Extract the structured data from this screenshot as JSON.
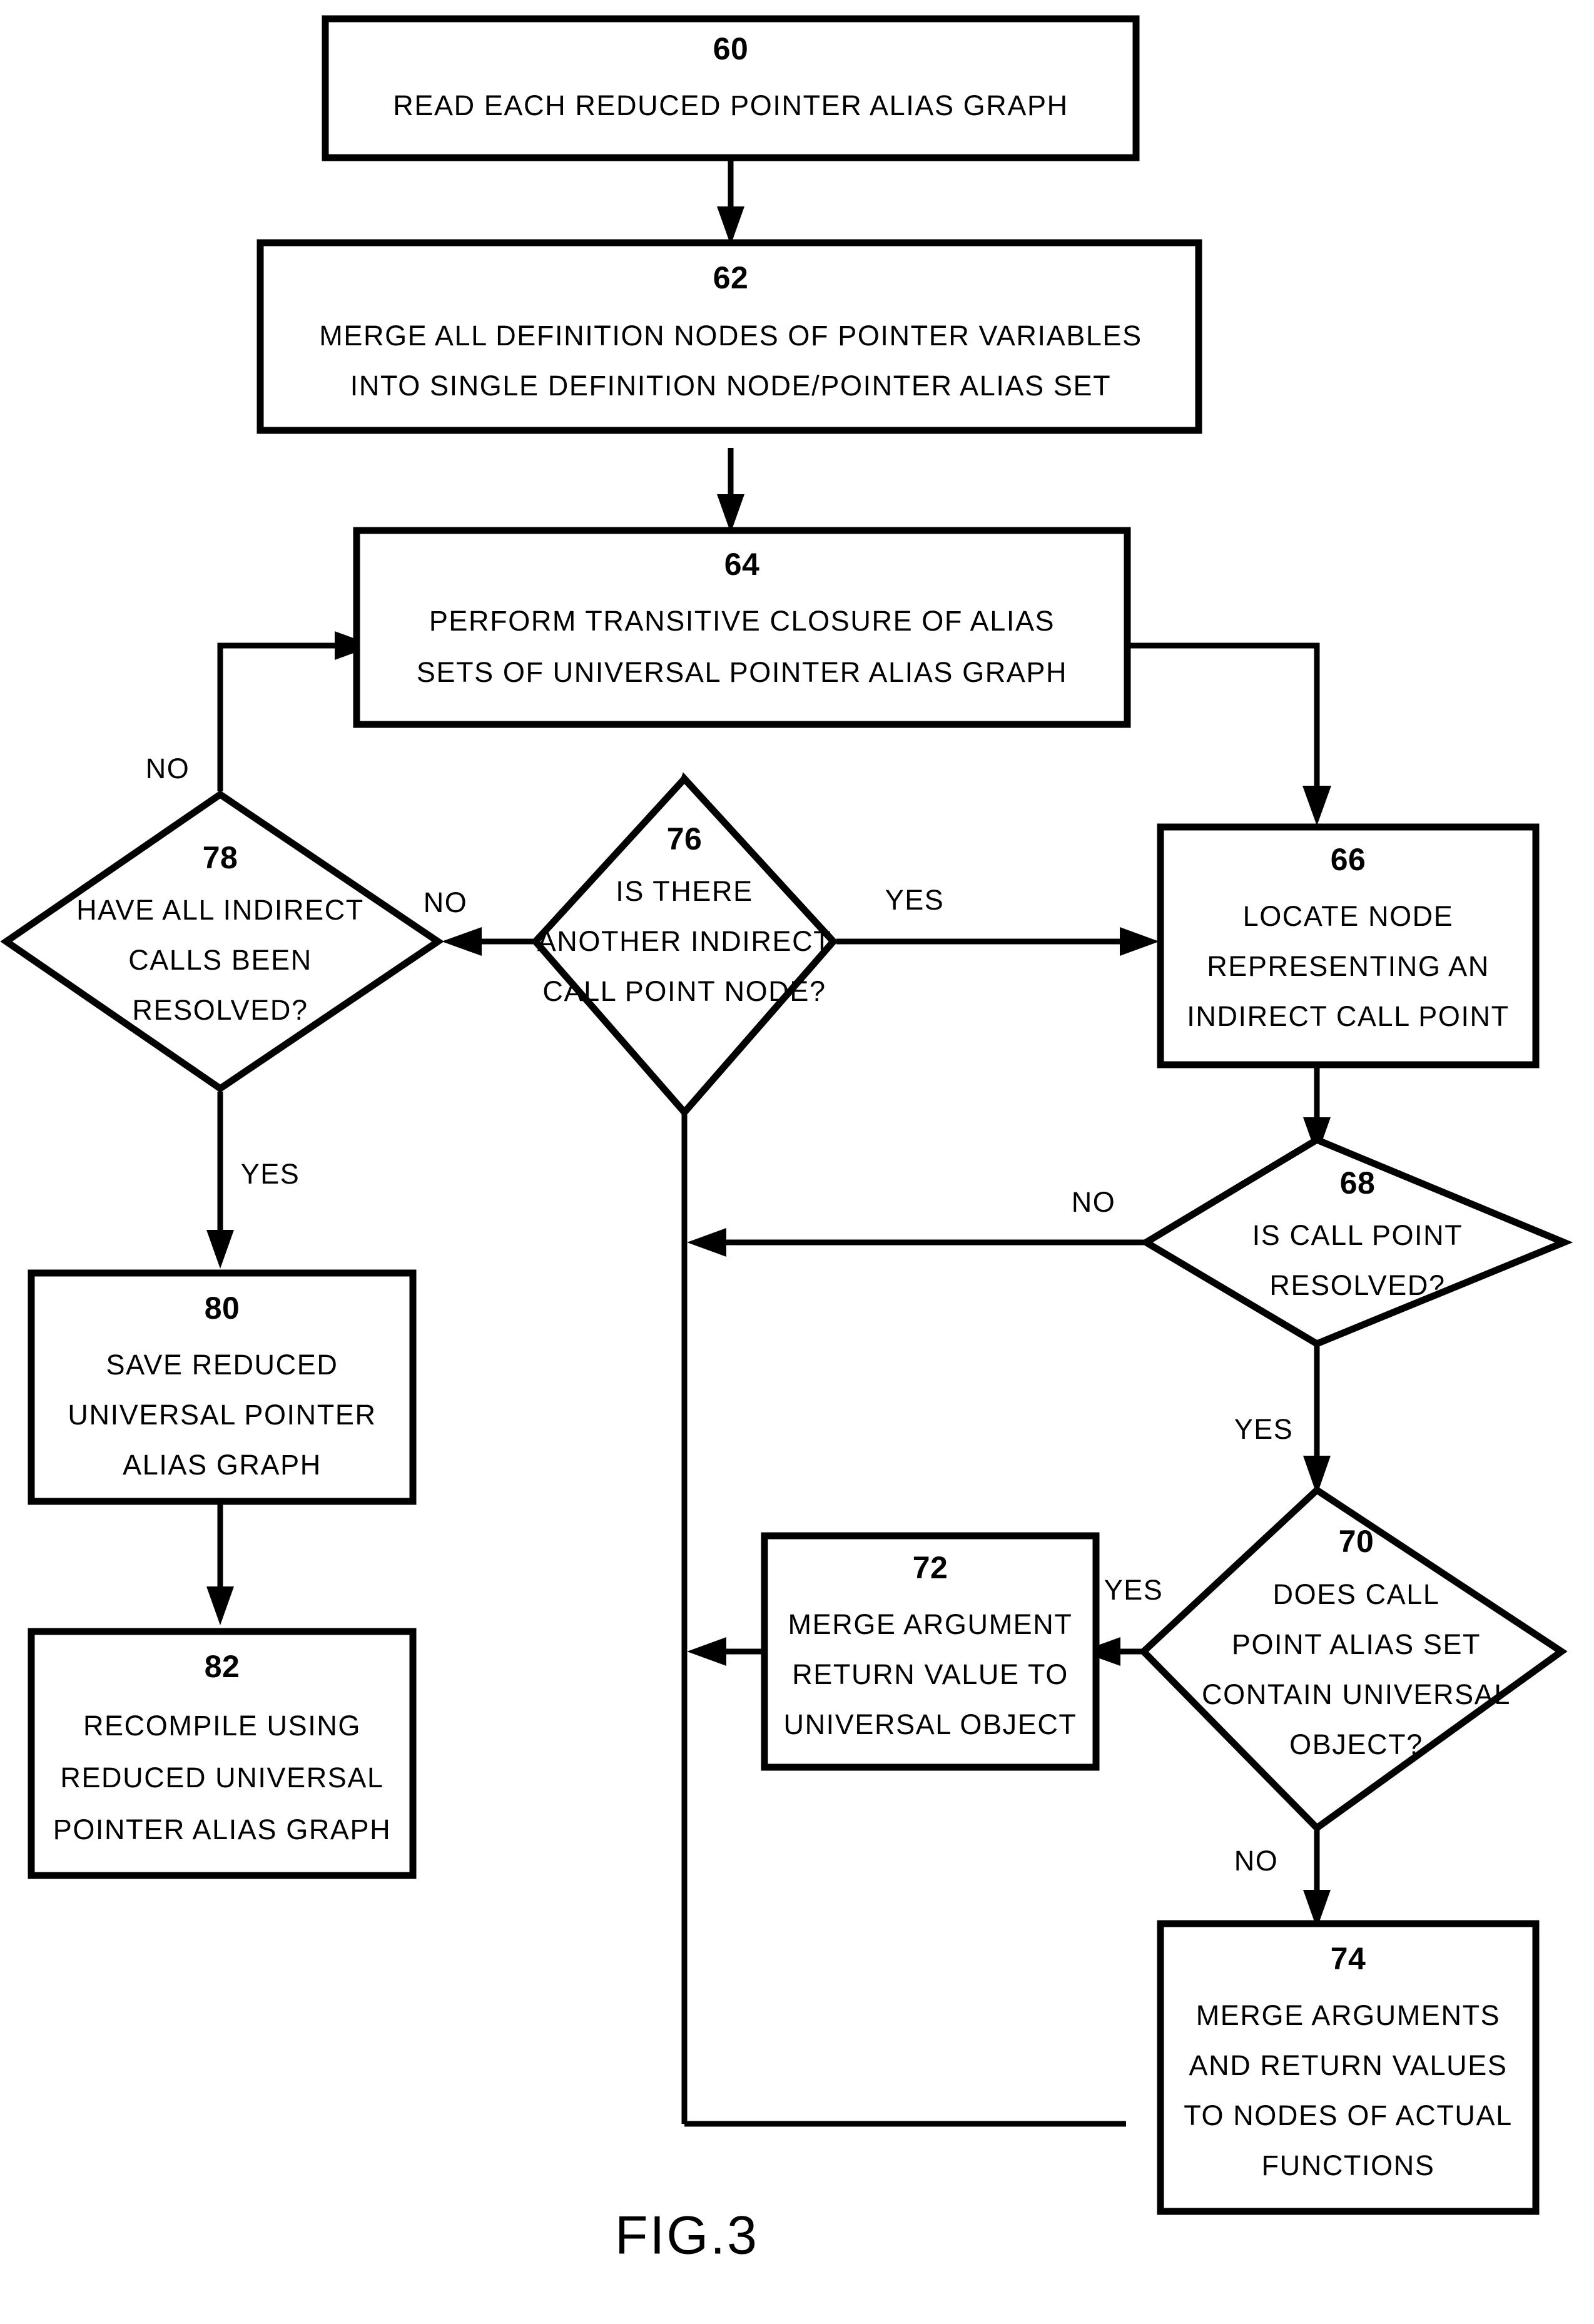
{
  "figure": {
    "label": "FIG.3",
    "title": "FIG.3"
  },
  "nodes": {
    "n60": {
      "ref": "60",
      "shape": "process",
      "lines": [
        "READ EACH REDUCED POINTER ALIAS GRAPH"
      ]
    },
    "n62": {
      "ref": "62",
      "shape": "process",
      "lines": [
        "MERGE ALL DEFINITION NODES OF POINTER VARIABLES",
        "INTO SINGLE DEFINITION NODE/POINTER ALIAS SET"
      ]
    },
    "n64": {
      "ref": "64",
      "shape": "process",
      "lines": [
        "PERFORM TRANSITIVE CLOSURE OF ALIAS",
        "SETS OF UNIVERSAL POINTER ALIAS GRAPH"
      ]
    },
    "n66": {
      "ref": "66",
      "shape": "process",
      "lines": [
        "LOCATE NODE",
        "REPRESENTING AN",
        "INDIRECT CALL POINT"
      ]
    },
    "n68": {
      "ref": "68",
      "shape": "decision",
      "lines": [
        "IS CALL POINT",
        "RESOLVED?"
      ]
    },
    "n70": {
      "ref": "70",
      "shape": "decision",
      "lines": [
        "DOES CALL",
        "POINT ALIAS SET",
        "CONTAIN UNIVERSAL",
        "OBJECT?"
      ]
    },
    "n72": {
      "ref": "72",
      "shape": "process",
      "lines": [
        "MERGE ARGUMENT",
        "RETURN VALUE TO",
        "UNIVERSAL OBJECT"
      ]
    },
    "n74": {
      "ref": "74",
      "shape": "process",
      "lines": [
        "MERGE ARGUMENTS",
        "AND RETURN VALUES",
        "TO NODES OF ACTUAL",
        "FUNCTIONS"
      ]
    },
    "n76": {
      "ref": "76",
      "shape": "decision",
      "lines": [
        "IS THERE",
        "ANOTHER INDIRECT",
        "CALL POINT NODE?"
      ]
    },
    "n78": {
      "ref": "78",
      "shape": "decision",
      "lines": [
        "HAVE ALL INDIRECT",
        "CALLS BEEN",
        "RESOLVED?"
      ]
    },
    "n80": {
      "ref": "80",
      "shape": "process",
      "lines": [
        "SAVE REDUCED",
        "UNIVERSAL POINTER",
        "ALIAS GRAPH"
      ]
    },
    "n82": {
      "ref": "82",
      "shape": "process",
      "lines": [
        "RECOMPILE USING",
        "REDUCED UNIVERSAL",
        "POINTER ALIAS GRAPH"
      ]
    }
  },
  "edge_labels": {
    "e78_no_in": "NO",
    "e76_no": "NO",
    "e76_yes": "YES",
    "e78_yes": "YES",
    "e68_no": "NO",
    "e68_yes": "YES",
    "e70_yes": "YES",
    "e70_no": "NO"
  },
  "colors": {
    "stroke": "#000000",
    "fill": "#ffffff",
    "background": "#ffffff"
  }
}
